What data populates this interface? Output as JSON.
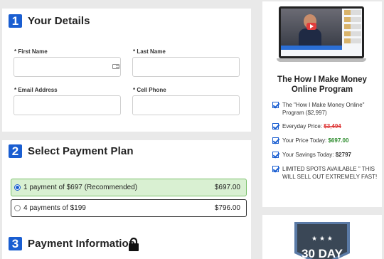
{
  "details": {
    "number": "1",
    "title": "Your Details",
    "first_name_label": "* First Name",
    "last_name_label": "* Last Name",
    "email_label": "* Email Address",
    "phone_label": "* Cell Phone"
  },
  "payment_plan": {
    "number": "2",
    "title": "Select Payment Plan",
    "options": [
      {
        "label": "1 payment of $697 (Recommended)",
        "price": "$697.00",
        "selected": true
      },
      {
        "label": "4 payments of $199",
        "price": "$796.00",
        "selected": false
      }
    ]
  },
  "payment_info": {
    "number": "3",
    "title": "Payment Information"
  },
  "sidebar": {
    "program_title": "The How I Make Money Online Program",
    "bullets": [
      {
        "text": "The \"How I Make Money Online\" Program ($2,997)"
      },
      {
        "prefix": "Everyday Price: ",
        "value": "$3,494"
      },
      {
        "prefix": "Your Price Today: ",
        "value": "$697.00"
      },
      {
        "prefix": "Your Savings Today: ",
        "value": "$2797"
      },
      {
        "text": "LIMITED SPOTS AVAILABLE \" THIS WILL SELL OUT EXTREMELY FAST!"
      }
    ],
    "guarantee_badge": "30 DAY"
  },
  "colors": {
    "accent": "#1a5ed1",
    "selected_bg": "#d9f0d2",
    "strike_red": "#d33",
    "price_green": "#2a8a2a"
  }
}
